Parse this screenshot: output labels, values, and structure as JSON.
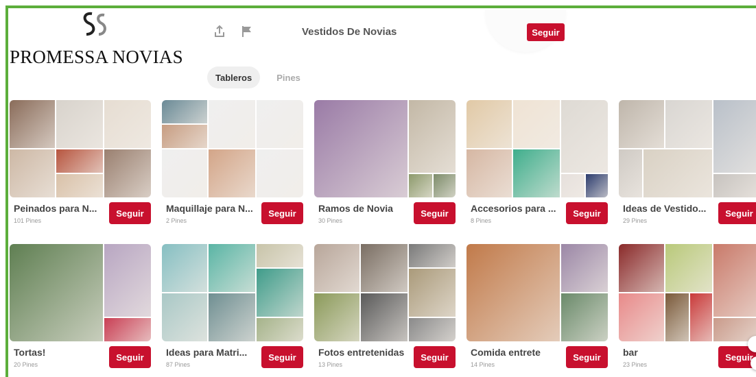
{
  "logo": {
    "mark": "SS",
    "text": "PROMESSA NOVIAS"
  },
  "header": {
    "share_icon": "share-icon",
    "flag_icon": "flag-icon",
    "title": "Vestidos De Novias",
    "follow_label": "Seguir"
  },
  "tabs": [
    {
      "label": "Tableros",
      "active": true
    },
    {
      "label": "Pines",
      "active": false
    }
  ],
  "boards": [
    {
      "name": "Peinados para N...",
      "count": "101 Pines",
      "follow": "Seguir",
      "tiles": [
        "#8a6c5a",
        "#d8d3cc",
        "#e6ddd2",
        "#cdb8a5",
        "#b7553f",
        "#d9c1a8",
        "#9a8070"
      ]
    },
    {
      "name": "Maquillaje para N...",
      "count": "2 Pines",
      "follow": "Seguir",
      "tiles": [
        "#6a8a96",
        "#c79d82",
        "#efefef",
        "#efefef",
        "#d3a588",
        "#efefef",
        "#efefef"
      ]
    },
    {
      "name": "Ramos de Novia",
      "count": "30 Pines",
      "follow": "Seguir",
      "tiles": [
        "#9a7ba6",
        "#c3b8a6",
        "#8d9a6c",
        "#7d8c6a"
      ]
    },
    {
      "name": "Accesorios para ...",
      "count": "8 Pines",
      "follow": "Seguir",
      "tiles": [
        "#e1c9a6",
        "#efe3d4",
        "#dedad4",
        "#d6b7a3",
        "#3fae8c",
        "#e6e0dc",
        "#2d3d6e"
      ]
    },
    {
      "name": "Ideas de Vestido...",
      "count": "29 Pines",
      "follow": "Seguir",
      "tiles": [
        "#bfb6ab",
        "#d9d6d2",
        "#b9c0c9",
        "#cfcac4",
        "#d9d1c4",
        "#c7c3bf"
      ]
    },
    {
      "name": "Tortas!",
      "count": "20 Pines",
      "follow": "Seguir",
      "tiles": [
        "#5f7f52",
        "#b8a6c2",
        "#c93f54"
      ]
    },
    {
      "name": "Ideas para Matri...",
      "count": "87 Pines",
      "follow": "Seguir",
      "tiles": [
        "#86bfc2",
        "#5ab5a5",
        "#c8c4a9",
        "#a9c8c6",
        "#6f8f92",
        "#3f9c8a",
        "#a5b38a"
      ]
    },
    {
      "name": "Fotos entretenidas",
      "count": "13 Pines",
      "follow": "Seguir",
      "tiles": [
        "#b8a69a",
        "#7a6e63",
        "#7a7a7a",
        "#8b9a5a",
        "#5a5a5a",
        "#aa9a7a",
        "#8a8a8a"
      ]
    },
    {
      "name": "Comida entrete",
      "count": "14 Pines",
      "follow": "Seguir",
      "tiles": [
        "#c17a4a",
        "#9b87a6",
        "#6a8a6a"
      ]
    },
    {
      "name": "bar",
      "count": "23 Pines",
      "follow": "Seguir",
      "tiles": [
        "#8a2a2a",
        "#b9c97a",
        "#c97a6a",
        "#e88a8a",
        "#7a5a3a",
        "#c93a3a",
        "#c99a8a"
      ]
    }
  ],
  "colors": {
    "accent": "#c8102e",
    "frame": "#5cae3b"
  }
}
